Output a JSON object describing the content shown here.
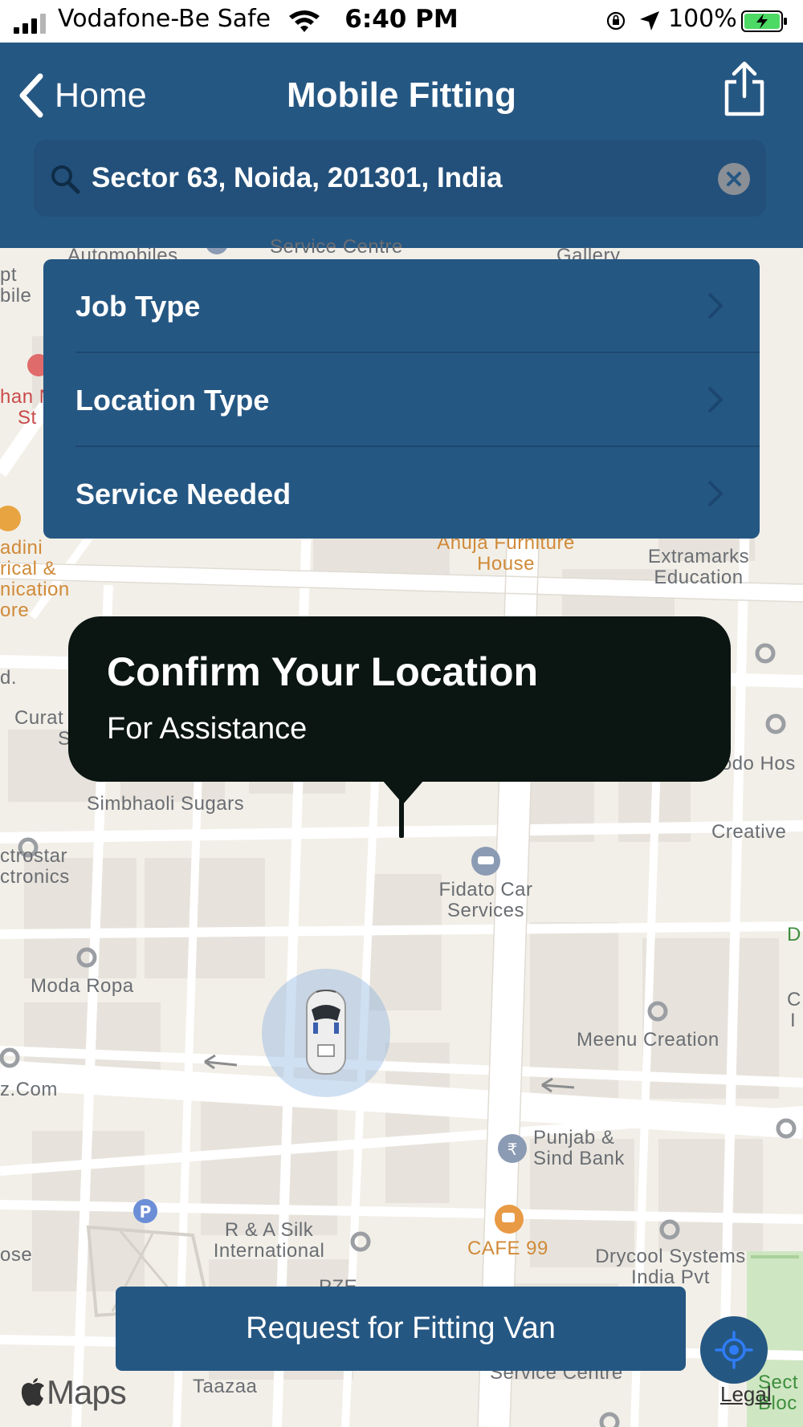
{
  "status_bar": {
    "carrier": "Vodafone-Be Safe",
    "time": "6:40 PM",
    "battery_percent": "100%"
  },
  "nav": {
    "back_label": "Home",
    "title": "Mobile Fitting"
  },
  "search": {
    "value": "Sector 63, Noida, 201301, India"
  },
  "menu": {
    "items": [
      {
        "label": "Job Type"
      },
      {
        "label": "Location Type"
      },
      {
        "label": "Service Needed"
      }
    ]
  },
  "callout": {
    "title": "Confirm Your Location",
    "subtitle": "For  Assistance"
  },
  "map": {
    "labels": {
      "automobiles": "Automobiles",
      "service_centre_top": "Service Centre",
      "gallery": "Gallery",
      "pt": "pt",
      "bile": "bile",
      "han_n": "han N",
      "st": "St",
      "adini": "adini",
      "rical": "rical &",
      "nication": "nication",
      "ore": "ore",
      "ahuja": "Ahuja Furniture",
      "house": "House",
      "extramarks": "Extramarks",
      "education": "Education",
      "d_dot": "d.",
      "curat": "Curat",
      "s_letter": "S",
      "oodo": "oodo Hos",
      "simbhaoli": "Simbhaoli Sugars",
      "creative": "Creative",
      "ctrostar": "ctrostar",
      "ctronics": "ctronics",
      "fidato_1": "Fidato Car",
      "fidato_2": "Services",
      "d_green": "D",
      "moda_ropa": "Moda Ropa",
      "c_right": "C",
      "i_right": "I",
      "meenu": "Meenu Creation",
      "zcom": "z.Com",
      "punjab_1": "Punjab &",
      "punjab_2": "Sind Bank",
      "ra_silk_1": "R & A Silk",
      "ra_silk_2": "International",
      "ose": "ose",
      "cafe": "CAFE 99",
      "drycool_1": "Drycool Systems",
      "drycool_2": "India Pvt",
      "pze": "PZE",
      "service_centre_bottom": "Service Centre",
      "taazaa": "Taazaa",
      "sect": "Sect",
      "bloc": "Bloc"
    }
  },
  "buttons": {
    "request": "Request for Fitting Van"
  },
  "attribution": {
    "maps": "Maps",
    "legal": "Legal"
  },
  "colors": {
    "primary": "#255783",
    "callout": "#0b1512",
    "map_bg": "#f2efe8",
    "road": "#ffffff",
    "poi_orange": "#d08a39"
  }
}
